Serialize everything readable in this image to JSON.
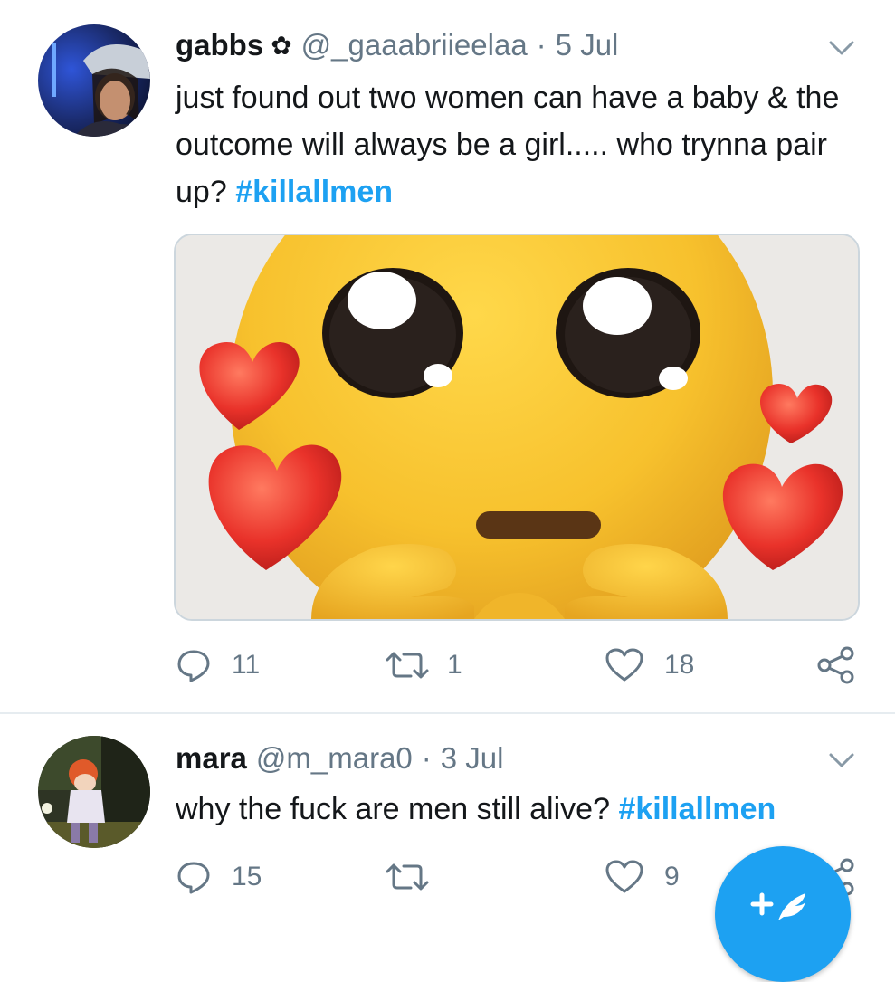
{
  "tweets": [
    {
      "name": "gabbs",
      "name_badge_icon": "flower-icon",
      "handle": "@_gaaabriieelaa",
      "separator": "·",
      "date": "5 Jul",
      "text": "just found out two women can have a baby & the outcome will always be a girl..... who trynna pair up?",
      "hashtag": "#killallmen",
      "media": "photo-pleading-face-emoji-with-hearts",
      "replies": "11",
      "retweets": "1",
      "likes": "18"
    },
    {
      "name": "mara",
      "handle": "@m_mara0",
      "separator": "·",
      "date": "3 Jul",
      "text": "why the fuck are men still alive?",
      "hashtag": "#killallmen",
      "replies": "15",
      "retweets": "",
      "likes": "9"
    }
  ],
  "icons": {
    "reply": "reply-icon",
    "retweet": "retweet-icon",
    "like": "heart-icon",
    "share": "share-icon",
    "more": "chevron-down-icon",
    "compose": "compose-tweet-icon"
  },
  "colors": {
    "link": "#1da1f2",
    "secondary_text": "#657786",
    "primary_text": "#14171a",
    "divider": "#e6ecf0",
    "fab": "#1da1f2"
  }
}
